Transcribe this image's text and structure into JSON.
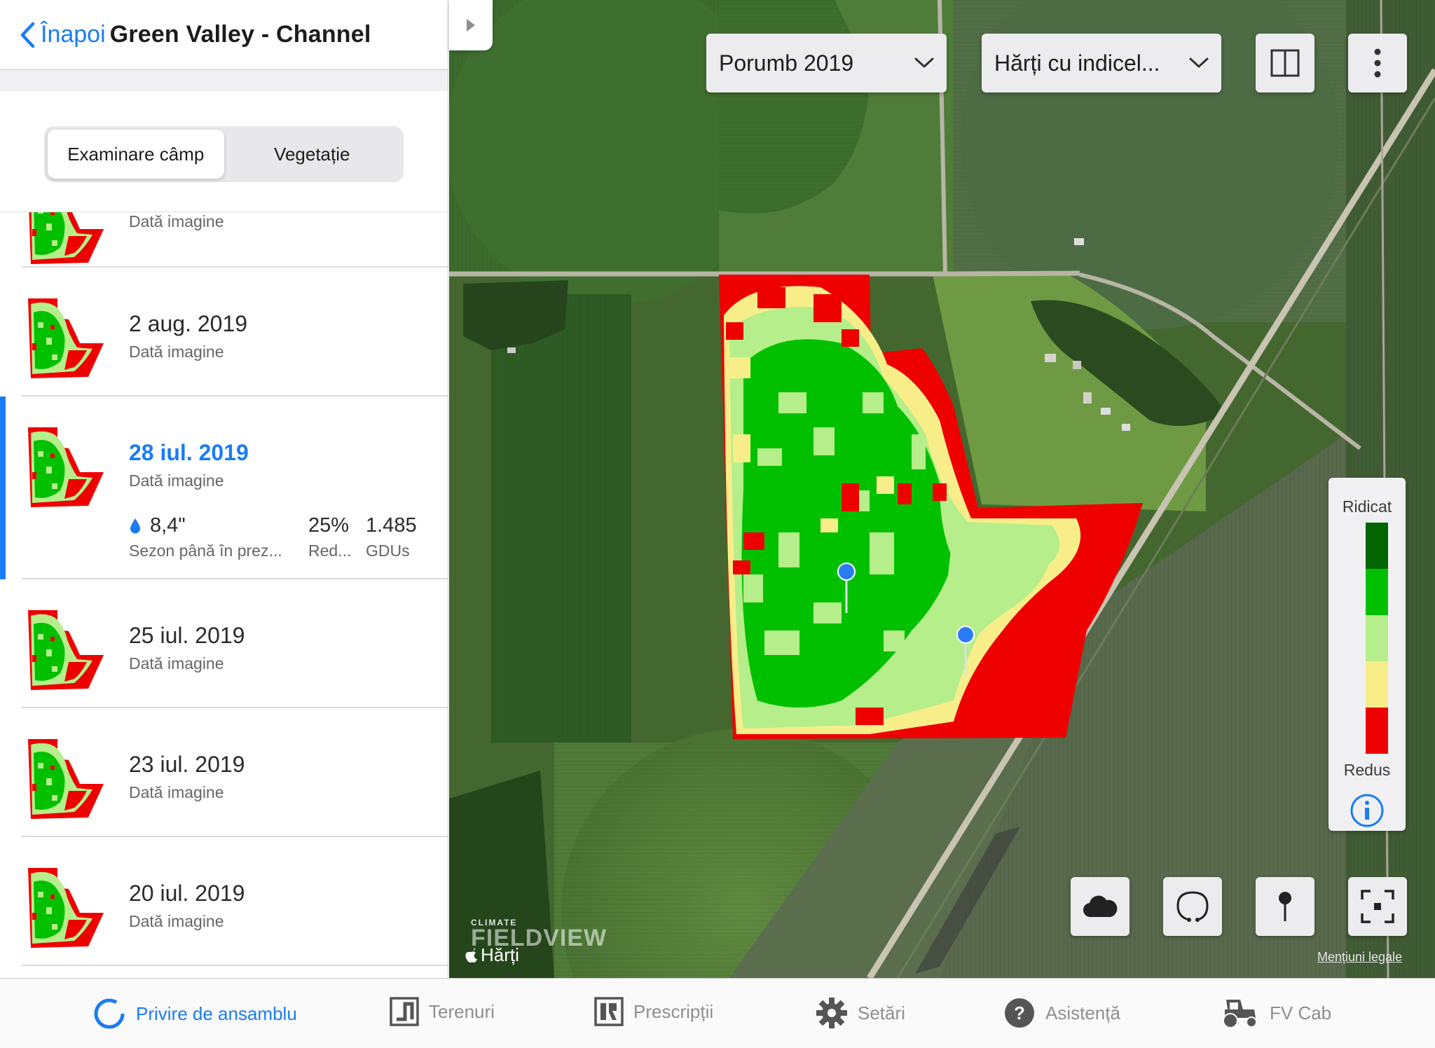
{
  "nav": {
    "back_label": "Înapoi",
    "title": "Green Valley - Channel"
  },
  "segments": {
    "tab1": "Examinare câmp",
    "tab2": "Vegetație",
    "active": "tab1"
  },
  "list": {
    "partial_sub": "Dată imagine",
    "items": [
      {
        "date": "2 aug. 2019",
        "sub": "Dată imagine"
      },
      {
        "date": "28 iul. 2019",
        "sub": "Dată imagine",
        "selected": true
      },
      {
        "date": "25 iul. 2019",
        "sub": "Dată imagine"
      },
      {
        "date": "23 iul. 2019",
        "sub": "Dată imagine"
      },
      {
        "date": "20 iul. 2019",
        "sub": "Dată imagine"
      }
    ],
    "stats": {
      "rain_value": "8,4\"",
      "rain_label": "Sezon până în prez...",
      "red_value": "25%",
      "red_label": "Red...",
      "gdu_value": "1.485",
      "gdu_label": "GDUs"
    }
  },
  "toolbar": {
    "crop_select": "Porumb 2019",
    "map_select": "Hărți cu indicel..."
  },
  "legend": {
    "high": "Ridicat",
    "low": "Redus",
    "colors": [
      "#006400",
      "#00c000",
      "#b5ee8a",
      "#f7ee8a",
      "#ee0000"
    ]
  },
  "map": {
    "brand_top": "CLIMATE",
    "brand_main": "FIELDVIEW",
    "maps_label": "Hărți",
    "legal": "Mențiuni legale"
  },
  "tabs": {
    "overview": "Privire de ansamblu",
    "fields": "Terenuri",
    "prescriptions": "Prescripții",
    "settings": "Setări",
    "support": "Asistență",
    "cab": "FV Cab"
  }
}
